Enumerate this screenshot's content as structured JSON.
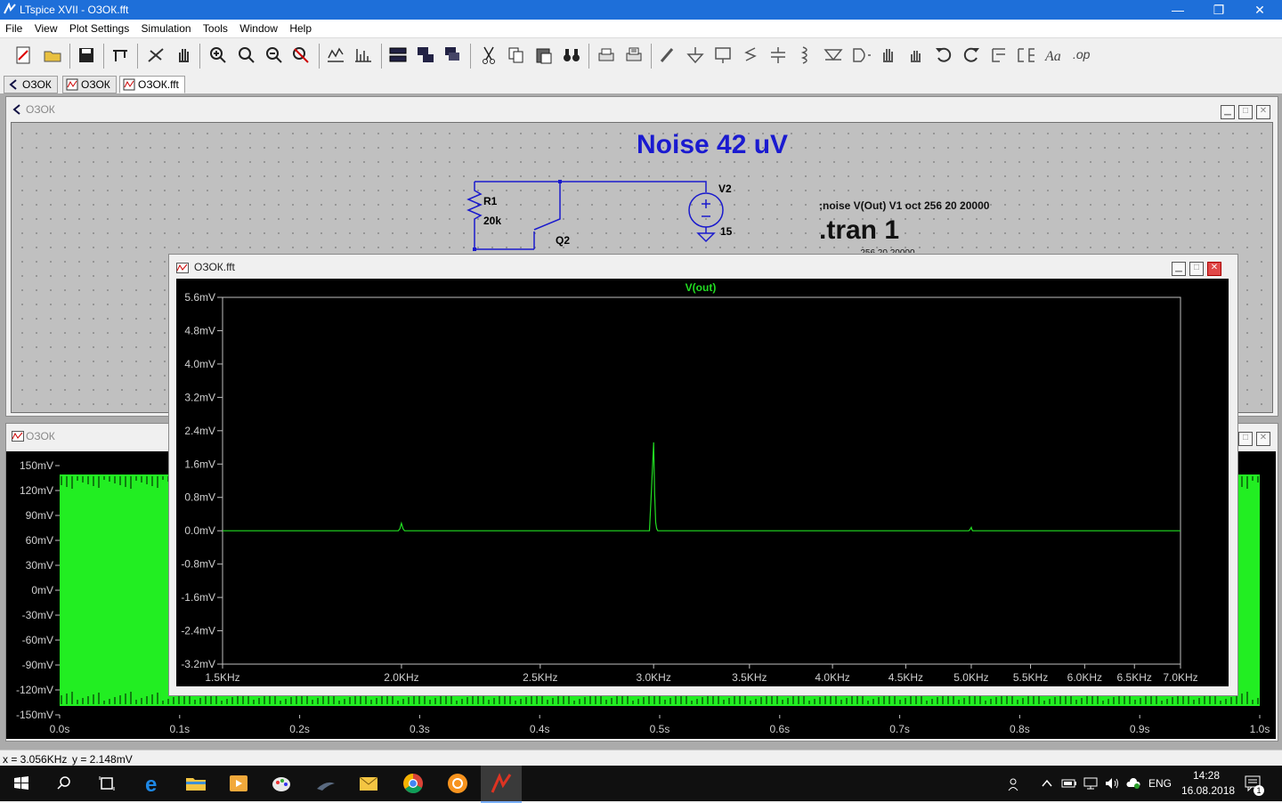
{
  "window": {
    "title": "LTspice XVII - ОЗОК.fft",
    "minimize": "—",
    "restore": "❐",
    "close": "✕"
  },
  "menu": [
    "File",
    "View",
    "Plot Settings",
    "Simulation",
    "Tools",
    "Window",
    "Help"
  ],
  "tabs": [
    {
      "label": "ОЗОК",
      "icon": "schematic-icon",
      "active": false
    },
    {
      "label": "ОЗОК",
      "icon": "waveform-icon",
      "active": false
    },
    {
      "label": "ОЗОК.fft",
      "icon": "waveform-icon",
      "active": true
    }
  ],
  "schematic": {
    "window_title": "ОЗОК",
    "heading": "Noise 42 uV",
    "noise_directive": ";noise V(Out) V1 oct 256 20 20000",
    "tran_directive": ".tran 1",
    "partial_line": "...256 20 20000",
    "r1_name": "R1",
    "r1_value": "20k",
    "v2_name": "V2",
    "v2_value": "15",
    "q2_name": "Q2"
  },
  "wave_window": {
    "title": "ОЗОК",
    "y_ticks": [
      "150mV",
      "120mV",
      "90mV",
      "60mV",
      "30mV",
      "0mV",
      "-30mV",
      "-60mV",
      "-90mV",
      "-120mV",
      "-150mV"
    ],
    "x_ticks": [
      "0.0s",
      "0.1s",
      "0.2s",
      "0.3s",
      "0.4s",
      "0.5s",
      "0.6s",
      "0.7s",
      "0.8s",
      "0.9s",
      "1.0s"
    ]
  },
  "fft_window": {
    "title": "ОЗОК.fft"
  },
  "chart_data": {
    "type": "line",
    "title": "V(out)",
    "xlabel": "",
    "ylabel": "",
    "x_scale": "log",
    "xlim": [
      1500,
      7000
    ],
    "ylim": [
      -3.2,
      5.6
    ],
    "x_ticks": [
      "1.5KHz",
      "2.0KHz",
      "2.5KHz",
      "3.0KHz",
      "3.5KHz",
      "4.0KHz",
      "4.5KHz",
      "5.0KHz",
      "5.5KHz",
      "6.0KHz",
      "6.5KHz",
      "7.0KHz"
    ],
    "x_tick_values": [
      1500,
      2000,
      2500,
      3000,
      3500,
      4000,
      4500,
      5000,
      5500,
      6000,
      6500,
      7000
    ],
    "y_ticks": [
      "5.6mV",
      "4.8mV",
      "4.0mV",
      "3.2mV",
      "2.4mV",
      "1.6mV",
      "0.8mV",
      "0.0mV",
      "-0.8mV",
      "-1.6mV",
      "-2.4mV",
      "-3.2mV"
    ],
    "y_tick_values": [
      5.6,
      4.8,
      4.0,
      3.2,
      2.4,
      1.6,
      0.8,
      0.0,
      -0.8,
      -1.6,
      -2.4,
      -3.2
    ],
    "series": [
      {
        "name": "V(out)",
        "color": "#22dd22",
        "x": [
          1500,
          1990,
          1995,
          2000,
          2005,
          2010,
          2980,
          2990,
          3000,
          3005,
          3010,
          3015,
          3020,
          4980,
          4990,
          5000,
          5005,
          5010,
          7000
        ],
        "y": [
          0.0,
          0.0,
          0.05,
          0.18,
          0.05,
          0.0,
          0.0,
          1.0,
          2.12,
          0.9,
          0.2,
          0.05,
          0.0,
          0.0,
          0.03,
          0.08,
          0.03,
          0.0,
          0.0
        ]
      }
    ],
    "grid": false,
    "background": "#000000"
  },
  "status": {
    "cursor_x": "x = 3.056KHz",
    "cursor_y": "y = 2.148mV"
  },
  "taskbar": {
    "lang": "ENG",
    "time": "14:28",
    "date": "16.08.2018",
    "notifications": "1"
  }
}
